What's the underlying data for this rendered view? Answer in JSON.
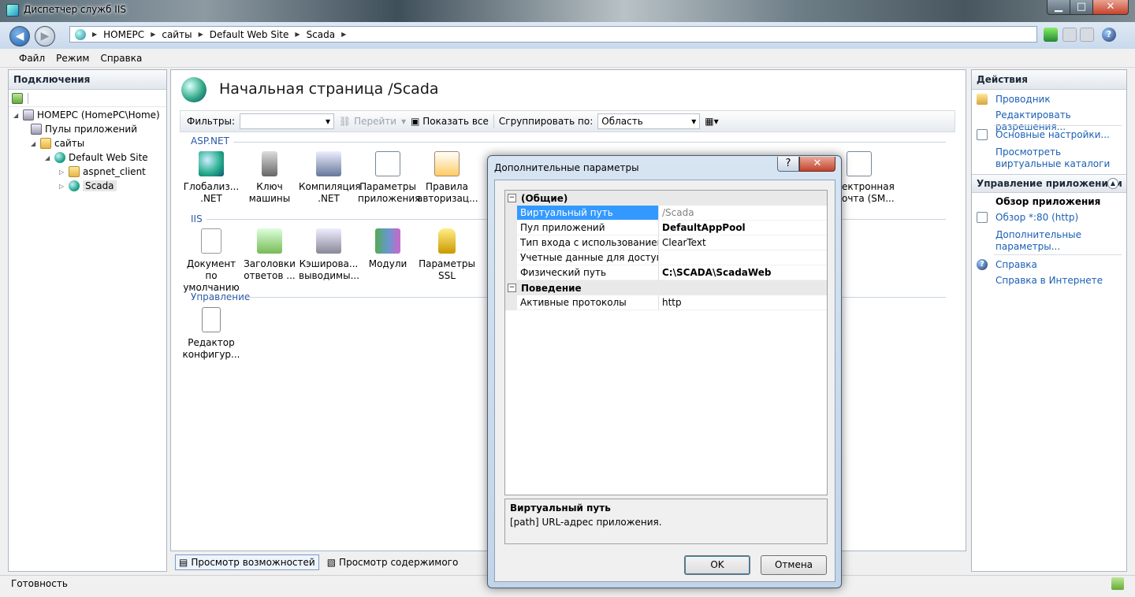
{
  "window": {
    "title": "Диспетчер служб IIS"
  },
  "address": {
    "crumbs": [
      "HOMEPC",
      "сайты",
      "Default Web Site",
      "Scada"
    ]
  },
  "menu": [
    "Файл",
    "Режим",
    "Справка"
  ],
  "left": {
    "header": "Подключения",
    "tree": [
      {
        "label": "HOMEPC (HomePC\\Home)"
      },
      {
        "label": "Пулы приложений"
      },
      {
        "label": "сайты"
      },
      {
        "label": "Default Web Site"
      },
      {
        "label": "aspnet_client"
      },
      {
        "label": "Scada"
      }
    ]
  },
  "center": {
    "heading": "Начальная страница /Scada",
    "filter_label": "Фильтры:",
    "go_label": "Перейти",
    "show_all_label": "Показать все",
    "group_by_label": "Сгруппировать по:",
    "group_by_value": "Область",
    "groups": [
      {
        "title": "ASP.NET",
        "items": [
          "Глобализ... .NET",
          "Ключ машины",
          "Компиляция .NET",
          "Параметры приложения",
          "Правила авторизац...",
          "ектронная очта (SM..."
        ]
      },
      {
        "title": "IIS",
        "items": [
          "Документ по умолчанию",
          "Заголовки ответов ...",
          "Кэширова... выводимы...",
          "Модули",
          "Параметры SSL"
        ]
      },
      {
        "title": "Управление",
        "items": [
          "Редактор конфигур..."
        ]
      }
    ],
    "view_tabs": [
      "Просмотр возможностей",
      "Просмотр содержимого"
    ]
  },
  "right": {
    "header": "Действия",
    "actions1": [
      "Проводник",
      "Редактировать разрешения...",
      "Основные настройки...",
      "Просмотреть виртуальные каталоги"
    ],
    "section_title": "Управление приложением",
    "subsection_title": "Обзор приложения",
    "actions2": [
      "Обзор *:80 (http)",
      "Дополнительные параметры..."
    ],
    "actions3": [
      "Справка",
      "Справка в Интернете"
    ]
  },
  "status": {
    "text": "Готовность"
  },
  "dialog": {
    "title": "Дополнительные параметры",
    "help_button": "?",
    "close_button": "✕",
    "categories": [
      {
        "name": "(Общие)",
        "rows": [
          {
            "name": "Виртуальный путь",
            "value": "/Scada"
          },
          {
            "name": "Пул приложений",
            "value": "DefaultAppPool"
          },
          {
            "name": "Тип входа с использованием уч",
            "value": "ClearText"
          },
          {
            "name": "Учетные данные для доступа к ф",
            "value": ""
          },
          {
            "name": "Физический путь",
            "value": "C:\\SCADA\\ScadaWeb"
          }
        ]
      },
      {
        "name": "Поведение",
        "rows": [
          {
            "name": "Активные протоколы",
            "value": "http"
          }
        ]
      }
    ],
    "description_title": "Виртуальный путь",
    "description_text": "[path] URL-адрес приложения.",
    "ok_label": "OK",
    "cancel_label": "Отмена"
  }
}
